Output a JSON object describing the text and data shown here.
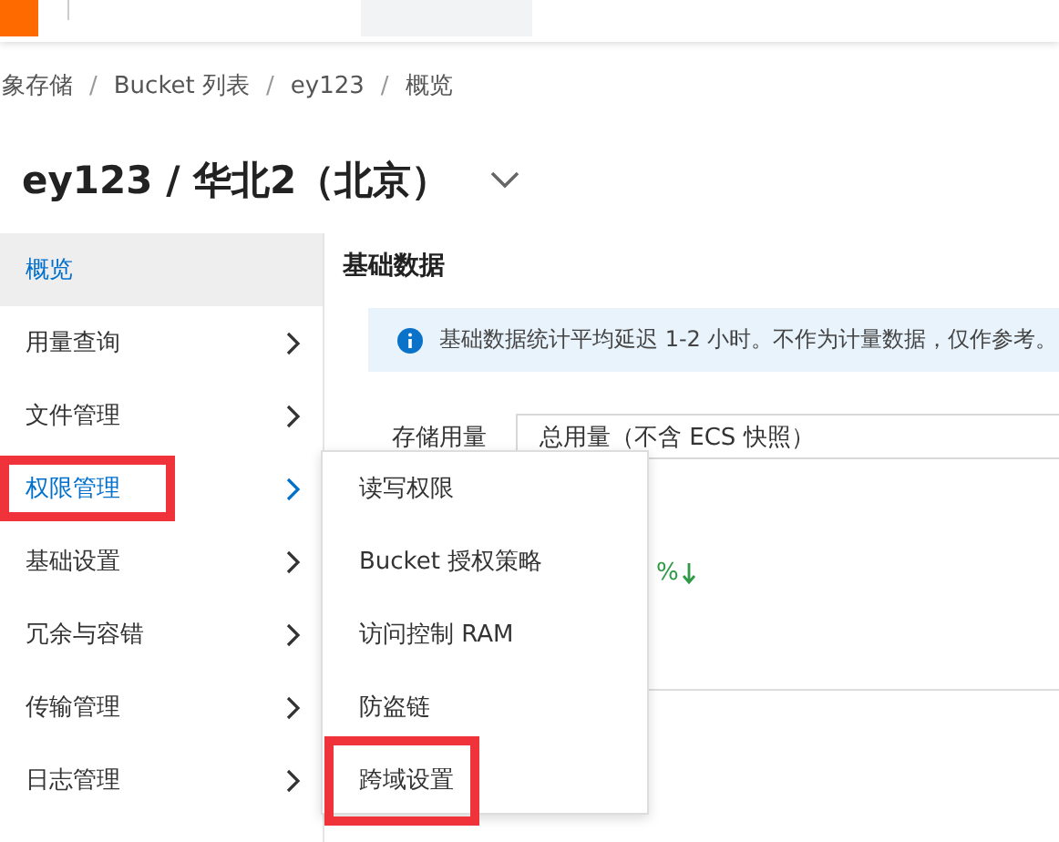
{
  "breadcrumb": {
    "separator": "/",
    "items": [
      "象存储",
      "Bucket 列表",
      "ey123",
      "概览"
    ]
  },
  "title": "ey123 / 华北2（北京）",
  "sidebar": [
    {
      "label": "概览",
      "selected": true,
      "expanded": false,
      "has_children": false,
      "highlighted": false
    },
    {
      "label": "用量查询",
      "selected": false,
      "expanded": false,
      "has_children": true,
      "highlighted": false
    },
    {
      "label": "文件管理",
      "selected": false,
      "expanded": false,
      "has_children": true,
      "highlighted": false
    },
    {
      "label": "权限管理",
      "selected": false,
      "expanded": true,
      "has_children": true,
      "highlighted": true
    },
    {
      "label": "基础设置",
      "selected": false,
      "expanded": false,
      "has_children": true,
      "highlighted": false
    },
    {
      "label": "冗余与容错",
      "selected": false,
      "expanded": false,
      "has_children": true,
      "highlighted": false
    },
    {
      "label": "传输管理",
      "selected": false,
      "expanded": false,
      "has_children": true,
      "highlighted": false
    },
    {
      "label": "日志管理",
      "selected": false,
      "expanded": false,
      "has_children": true,
      "highlighted": false
    }
  ],
  "section_title": "基础数据",
  "notice": "基础数据统计平均延迟 1-2 小时。不作为计量数据，仅作参考。",
  "storage": {
    "label": "存储用量",
    "value": "总用量（不含 ECS 快照）"
  },
  "change": {
    "text": "%"
  },
  "submenu": [
    {
      "label": "读写权限",
      "highlighted": false
    },
    {
      "label": "Bucket 授权策略",
      "highlighted": false
    },
    {
      "label": "访问控制 RAM",
      "highlighted": false
    },
    {
      "label": "防盗链",
      "highlighted": false
    },
    {
      "label": "跨域设置",
      "highlighted": true
    }
  ]
}
